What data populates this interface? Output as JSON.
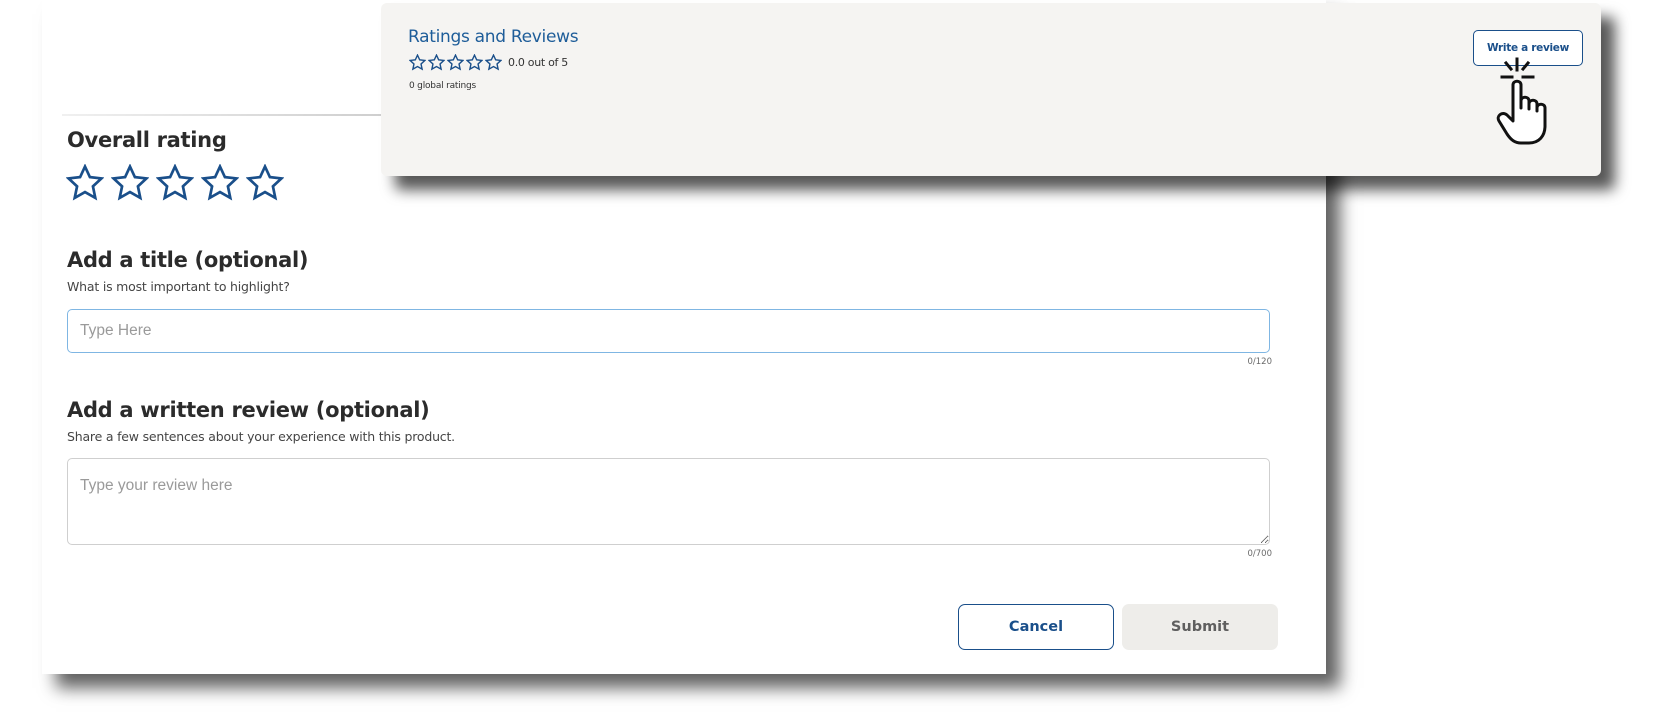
{
  "summary": {
    "title": "Ratings and Reviews",
    "average_text": "0.0 out of 5",
    "average_rating": 0,
    "max_rating": 5,
    "global_ratings": "0 global ratings",
    "write_review_label": "Write a review",
    "cursor_icon": "hand-pointer-click-icon"
  },
  "form": {
    "overall_rating_heading": "Overall rating",
    "selected_rating": 0,
    "star_icon": "star-outline-icon",
    "title_heading": "Add a title (optional)",
    "title_subtext": "What is most important to highlight?",
    "title_placeholder": "Type Here",
    "title_counter": "0/120",
    "review_heading": "Add a written review (optional)",
    "review_subtext": "Share a few sentences about your experience with this product.",
    "review_placeholder": "Type your review here",
    "review_counter": "0/700",
    "cancel_label": "Cancel",
    "submit_label": "Submit"
  },
  "colors": {
    "brand_blue": "#1a4f8a",
    "link_blue": "#1e5d99",
    "input_focus_border": "#7fb6e3",
    "summary_background": "#f5f4f2",
    "submit_disabled_bg": "#eeedea"
  }
}
